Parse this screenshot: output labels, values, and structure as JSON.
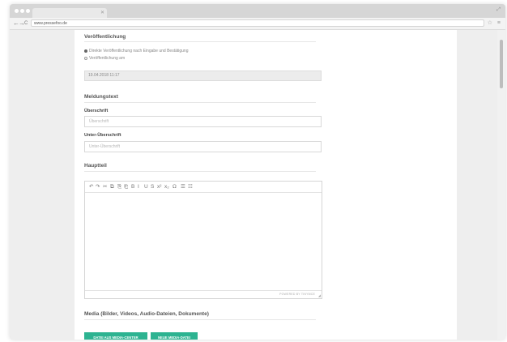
{
  "browser": {
    "url": "www.pressefoo.de",
    "nav": {
      "back": "←",
      "forward": "→",
      "reload": "C"
    },
    "url_icons": "☆ ≡"
  },
  "publication": {
    "title": "Veröffentlichung",
    "options": [
      {
        "label": "Direkte Veröffentlichung nach Eingabe und Bestätigung",
        "checked": true
      },
      {
        "label": "Veröffentlichung am",
        "checked": false
      }
    ],
    "date_value": "19.04.2018 11:17"
  },
  "message": {
    "title": "Meldungstext",
    "heading_label": "Überschrift",
    "heading_placeholder": "Überschrift",
    "subheading_label": "Unter-Überschrift",
    "subheading_placeholder": "Unter-Überschrift"
  },
  "main_body": {
    "title": "Hauptteil",
    "toolbar": [
      {
        "name": "undo-icon",
        "glyph": "↶"
      },
      {
        "name": "redo-icon",
        "glyph": "↷"
      },
      {
        "name": "cut-icon",
        "glyph": "✂"
      },
      {
        "name": "copy-icon",
        "glyph": "⧉"
      },
      {
        "name": "paste-icon",
        "glyph": "⎘"
      },
      {
        "name": "paste-text-icon",
        "glyph": "⎗"
      },
      {
        "name": "bold-icon",
        "glyph": "B"
      },
      {
        "name": "italic-icon",
        "glyph": "I"
      },
      {
        "name": "underline-icon",
        "glyph": "U"
      },
      {
        "name": "strikethrough-icon",
        "glyph": "S"
      },
      {
        "name": "superscript-icon",
        "glyph": "x²"
      },
      {
        "name": "subscript-icon",
        "glyph": "x₂"
      },
      {
        "name": "special-char-icon",
        "glyph": "Ω"
      },
      {
        "name": "bullet-list-icon",
        "glyph": "☰"
      },
      {
        "name": "numbered-list-icon",
        "glyph": "☷"
      }
    ],
    "powered_by": "POWERED BY TINYMCE"
  },
  "media": {
    "title": "Media (Bilder, Videos, Audio-Dateien, Dokumente)",
    "button_center": "DATEI AUS MEDIA-CENTER",
    "button_new": "NEUE MEDIA-DATEI",
    "accent_color": "#2db391"
  }
}
